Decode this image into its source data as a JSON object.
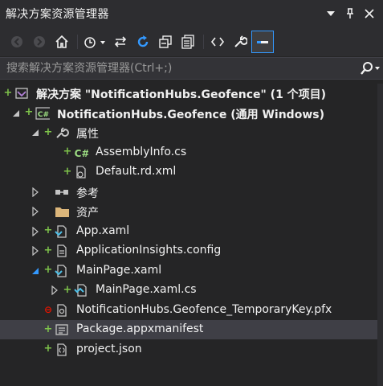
{
  "window": {
    "title": "解决方案资源管理器"
  },
  "search": {
    "placeholder": "搜索解决方案资源管理器(Ctrl+;)"
  },
  "tree": [
    {
      "label": "解决方案 \"NotificationHubs.Geofence\" (1 个项目)",
      "icon": "solution-icon",
      "bold": true,
      "depth": 0,
      "expander": "none",
      "status": "add"
    },
    {
      "label": "NotificationHubs.Geofence (通用 Windows)",
      "icon": "csharp-project-icon",
      "bold": true,
      "depth": 1,
      "expander": "expanded",
      "status": "add"
    },
    {
      "label": "属性",
      "icon": "wrench-icon",
      "bold": false,
      "depth": 2,
      "expander": "expanded",
      "status": "add"
    },
    {
      "label": "AssemblyInfo.cs",
      "icon": "csharp-file-icon",
      "bold": false,
      "depth": 3,
      "expander": "none",
      "status": "add"
    },
    {
      "label": "Default.rd.xml",
      "icon": "xml-file-icon",
      "bold": false,
      "depth": 3,
      "expander": "none",
      "status": "add"
    },
    {
      "label": "参考",
      "icon": "references-icon",
      "bold": false,
      "depth": 2,
      "expander": "collapsed",
      "status": "none"
    },
    {
      "label": "资产",
      "icon": "folder-icon",
      "bold": false,
      "depth": 2,
      "expander": "collapsed",
      "status": "none"
    },
    {
      "label": "App.xaml",
      "icon": "xaml-file-icon",
      "bold": false,
      "depth": 2,
      "expander": "collapsed",
      "status": "add"
    },
    {
      "label": "ApplicationInsights.config",
      "icon": "config-file-icon",
      "bold": false,
      "depth": 2,
      "expander": "collapsed",
      "status": "add"
    },
    {
      "label": "MainPage.xaml",
      "icon": "xaml-file-icon",
      "bold": false,
      "depth": 2,
      "expander": "expanded-selected",
      "status": "add"
    },
    {
      "label": "MainPage.xaml.cs",
      "icon": "xaml-cs-file-icon",
      "bold": false,
      "depth": 3,
      "expander": "collapsed",
      "status": "add"
    },
    {
      "label": "NotificationHubs.Geofence_TemporaryKey.pfx",
      "icon": "certificate-icon",
      "bold": false,
      "depth": 2,
      "expander": "none",
      "status": "error"
    },
    {
      "label": "Package.appxmanifest",
      "icon": "manifest-icon",
      "bold": false,
      "depth": 2,
      "expander": "none",
      "status": "add",
      "selected": true
    },
    {
      "label": "project.json",
      "icon": "json-file-icon",
      "bold": false,
      "depth": 2,
      "expander": "none",
      "status": "add"
    }
  ],
  "colors": {
    "background": "#252526",
    "selected_row": "#3f3f46",
    "status_add": "#7ec34a",
    "status_error": "#e51400",
    "accent": "#3399ff"
  }
}
